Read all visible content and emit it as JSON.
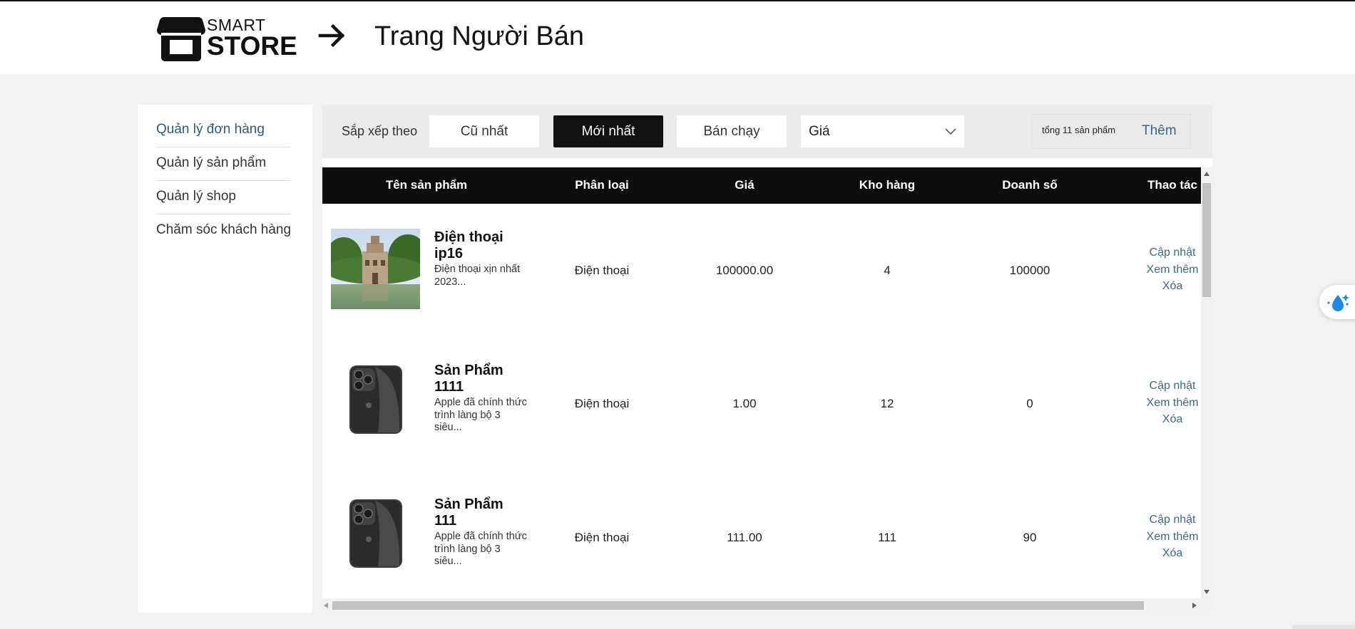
{
  "brand": {
    "line1": "SMART",
    "line2": "STORE"
  },
  "header": {
    "title": "Trang Người Bán"
  },
  "sidebar": {
    "items": [
      {
        "label": "Quản lý đơn hàng",
        "active": true
      },
      {
        "label": "Quản lý sản phẩm",
        "active": false
      },
      {
        "label": "Quản lý shop",
        "active": false
      },
      {
        "label": "Chăm sóc khách hàng",
        "active": false
      }
    ]
  },
  "toolbar": {
    "sort_label": "Sắp xếp theo",
    "sort_options": [
      {
        "label": "Cũ nhất",
        "active": false
      },
      {
        "label": "Mới nhất",
        "active": true
      },
      {
        "label": "Bán chạy",
        "active": false
      }
    ],
    "price_select": "Giá",
    "count_text": "tổng 11 sản phẩm",
    "add_label": "Thêm"
  },
  "table": {
    "headers": [
      "Tên sản phẩm",
      "Phân loại",
      "Giá",
      "Kho hàng",
      "Doanh số",
      "Thao tác"
    ],
    "actions": {
      "update": "Cập nhật",
      "more": "Xem thêm",
      "delete": "Xóa"
    },
    "rows": [
      {
        "name": "Điện thoại ip16",
        "description": "Điện thoại xịn nhất 2023...",
        "category": "Điện thoại",
        "price": "100000.00",
        "stock": "4",
        "sales": "100000",
        "image": "pagoda-lake-photo"
      },
      {
        "name": "Sản Phẩm 1111",
        "description": "Apple đã chính thức trình làng bộ 3 siêu...",
        "category": "Điện thoại",
        "price": "1.00",
        "stock": "12",
        "sales": "0",
        "image": "phone-photo"
      },
      {
        "name": "Sản Phẩm 111",
        "description": "Apple đã chính thức trình làng bộ 3 siêu...",
        "category": "Điện thoại",
        "price": "111.00",
        "stock": "111",
        "sales": "90",
        "image": "phone-photo"
      }
    ]
  },
  "colors": {
    "accent": "#3b6a85",
    "header_bg": "#0d0d0d",
    "active_button": "#111111"
  }
}
